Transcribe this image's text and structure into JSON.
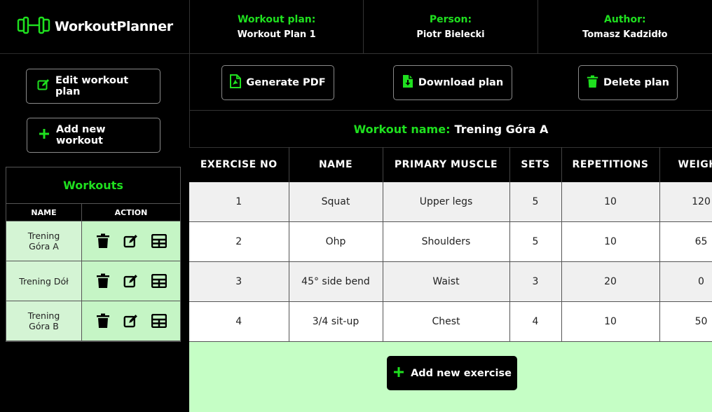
{
  "app": {
    "brand": "WorkoutPlanner"
  },
  "colors": {
    "accent": "#1fe01f",
    "background": "#000000",
    "row_green": "#d7f5d7",
    "bottom_green": "#c5fec5"
  },
  "sidebar": {
    "edit_plan_label": "Edit workout plan",
    "add_workout_label": "Add new workout",
    "workouts": {
      "title": "Workouts",
      "col_name": "NAME",
      "col_action": "ACTION",
      "rows": [
        {
          "name_line1": "Trening",
          "name_line2": "Góra A"
        },
        {
          "name_line1": "Trening Dół",
          "name_line2": ""
        },
        {
          "name_line1": "Trening",
          "name_line2": "Góra B"
        }
      ]
    }
  },
  "header": {
    "plan_label": "Workout plan:",
    "plan_value": "Workout Plan 1",
    "person_label": "Person:",
    "person_value": "Piotr Bielecki",
    "author_label": "Author:",
    "author_value": "Tomasz Kadzidło"
  },
  "actions": {
    "pdf_label": "Generate PDF",
    "download_label": "Download plan",
    "delete_label": "Delete plan"
  },
  "workout": {
    "name_label": "Workout name:",
    "name_value": "Trening Góra A"
  },
  "exercises": {
    "columns": [
      "EXERCISE NO",
      "NAME",
      "PRIMARY MUSCLE",
      "SETS",
      "REPETITIONS",
      "WEIGHT"
    ],
    "rows": [
      [
        "1",
        "Squat",
        "Upper legs",
        "5",
        "10",
        "120"
      ],
      [
        "2",
        "Ohp",
        "Shoulders",
        "5",
        "10",
        "65"
      ],
      [
        "3",
        "45° side bend",
        "Waist",
        "3",
        "20",
        "0"
      ],
      [
        "4",
        "3/4 sit-up",
        "Chest",
        "4",
        "10",
        "50"
      ]
    ],
    "add_label": "Add new exercise"
  }
}
